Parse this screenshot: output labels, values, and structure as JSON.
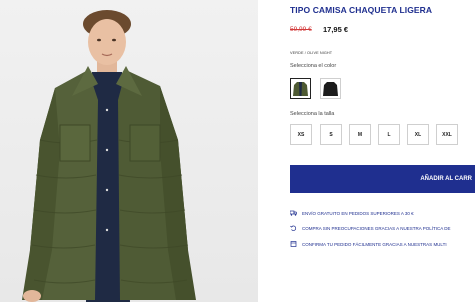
{
  "product": {
    "title": "TIPO CAMISA CHAQUETA LIGERA",
    "price_old": "59,99 €",
    "price_new": "17,95 €",
    "color_code": "VERDE / OLIVE NIGHT",
    "color_label": "Selecciona el color",
    "size_label": "Selecciona la talla"
  },
  "colors": [
    {
      "name": "olive-night",
      "swatch": "#4e5a33",
      "selected": true
    },
    {
      "name": "black",
      "swatch": "#1c1c1c",
      "selected": false
    }
  ],
  "sizes": [
    "XS",
    "S",
    "M",
    "L",
    "XL",
    "XXL"
  ],
  "cart_button": "AÑADIR AL CARR",
  "features": [
    {
      "icon": "truck-icon",
      "text": "ENVÍO GRATUITO EN PEDIDOS SUPERIORES A 30 €"
    },
    {
      "icon": "return-icon",
      "text": "COMPRA SIN PREOCUPACIONES GRACIAS A NUESTRA POLÍTICA DE"
    },
    {
      "icon": "calendar-icon",
      "text": "CONFIRMA TU PEDIDO FÁCILMENTE GRACIAS A NUESTRAS MULTI"
    }
  ],
  "colors_theme": {
    "brand": "#1f2f8f",
    "price_old": "#d23a3a"
  }
}
